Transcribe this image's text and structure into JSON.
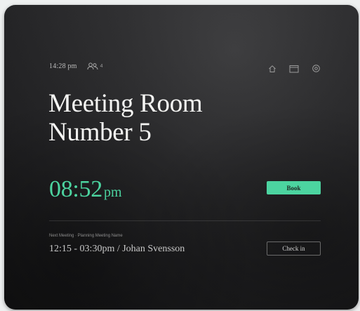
{
  "status": {
    "time": "14:28 pm",
    "attendee_count": "4"
  },
  "toolbar": {
    "icons": [
      "home-icon",
      "calendar-icon",
      "settings-icon"
    ]
  },
  "room": {
    "line1": "Meeting Room",
    "line2": "Number 5"
  },
  "clock": {
    "time": "08:52",
    "ampm": "pm"
  },
  "actions": {
    "book_label": "Book",
    "checkin_label": "Check in"
  },
  "next_meeting": {
    "label": "Next Meeting · Planning Meeting Name",
    "details": "12:15 - 03:30pm / Johan Svensson"
  },
  "colors": {
    "accent": "#4cd4a0",
    "background": "#1e1e20",
    "text": "#f4f4f2"
  }
}
